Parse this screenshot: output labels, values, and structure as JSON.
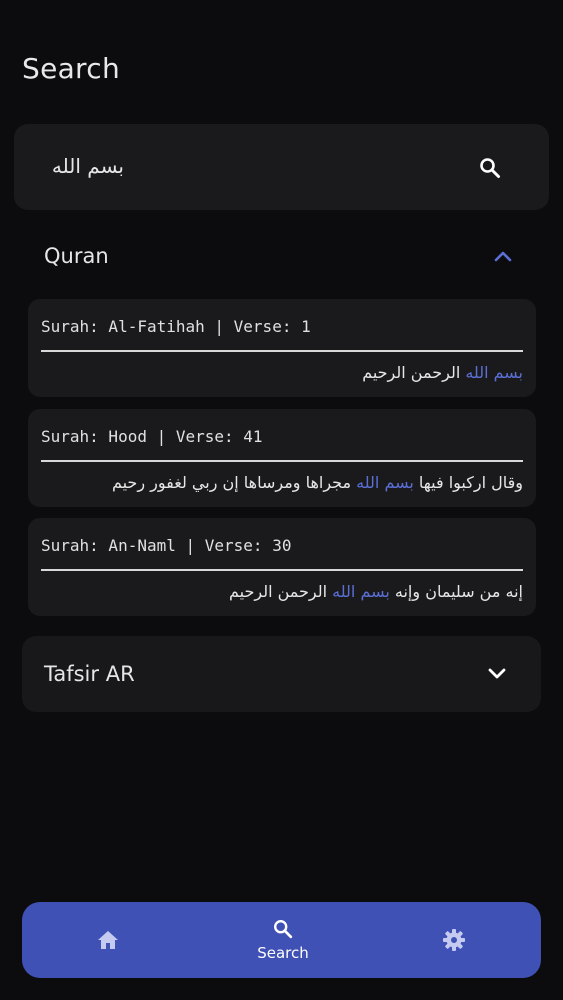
{
  "header": {
    "title": "Search"
  },
  "search": {
    "value": "بسم الله"
  },
  "sections": {
    "quran": {
      "label": "Quran"
    },
    "tafsir": {
      "label": "Tafsir AR"
    }
  },
  "results": [
    {
      "title": "Surah: Al-Fatihah | Verse: 1",
      "before": "",
      "match": "بسم الله",
      "after": " الرحمن الرحيم"
    },
    {
      "title": "Surah: Hood | Verse: 41",
      "before": "وقال اركبوا فيها ",
      "match": "بسم الله",
      "after": " مجراها ومرساها إن ربي لغفور رحيم"
    },
    {
      "title": "Surah: An-Naml | Verse: 30",
      "before": "إنه من سليمان وإنه ",
      "match": "بسم الله",
      "after": " الرحمن الرحيم"
    }
  ],
  "nav": {
    "search_label": "Search"
  },
  "colors": {
    "accent": "#3f51b5",
    "highlight": "#5b6fd6",
    "background": "#0c0c0e",
    "card": "#1a1a1c"
  },
  "icons": {
    "search": "search-icon",
    "expand": "chevron-up-icon",
    "collapse": "chevron-down-icon",
    "home": "home-icon",
    "settings": "gear-icon"
  }
}
